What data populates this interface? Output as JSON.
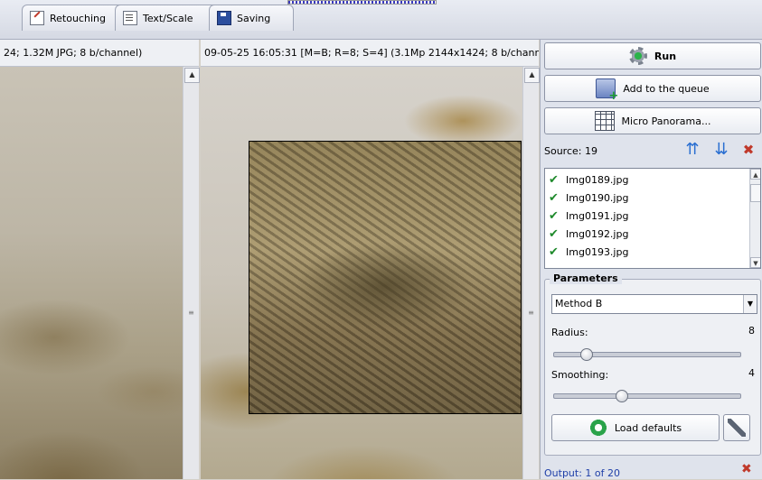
{
  "tabs": [
    {
      "label": "Retouching",
      "icon": "pencil-icon"
    },
    {
      "label": "Text/Scale",
      "icon": "document-icon"
    },
    {
      "label": "Saving",
      "icon": "disk-icon"
    }
  ],
  "left_info": "24; 1.32M JPG; 8 b/channel)",
  "right_info": "09-05-25 16:05:31 [M=B; R=8; S=4] (3.1Mp 2144x1424; 8 b/channel)",
  "actions": {
    "run_label": "Run",
    "queue_label": "Add to the queue",
    "panorama_label": "Micro Panorama..."
  },
  "source_label": "Source: 19",
  "files": [
    {
      "name": "Img0189.jpg",
      "status": "checked"
    },
    {
      "name": "Img0190.jpg",
      "status": "checked"
    },
    {
      "name": "Img0191.jpg",
      "status": "checked"
    },
    {
      "name": "Img0192.jpg",
      "status": "checked"
    },
    {
      "name": "Img0193.jpg",
      "status": "checked"
    }
  ],
  "parameters": {
    "header": "Parameters",
    "method": "Method B",
    "radius_label": "Radius:",
    "radius_value": "8",
    "radius_fraction": 0.15,
    "smoothing_label": "Smoothing:",
    "smoothing_value": "4",
    "smoothing_fraction": 0.35,
    "load_defaults_label": "Load defaults"
  },
  "output_label": "Output: 1 of 20",
  "colors": {
    "accent_blue": "#1f3fa8",
    "check_green": "#1f8a2c",
    "delete_red": "#c0392b"
  }
}
